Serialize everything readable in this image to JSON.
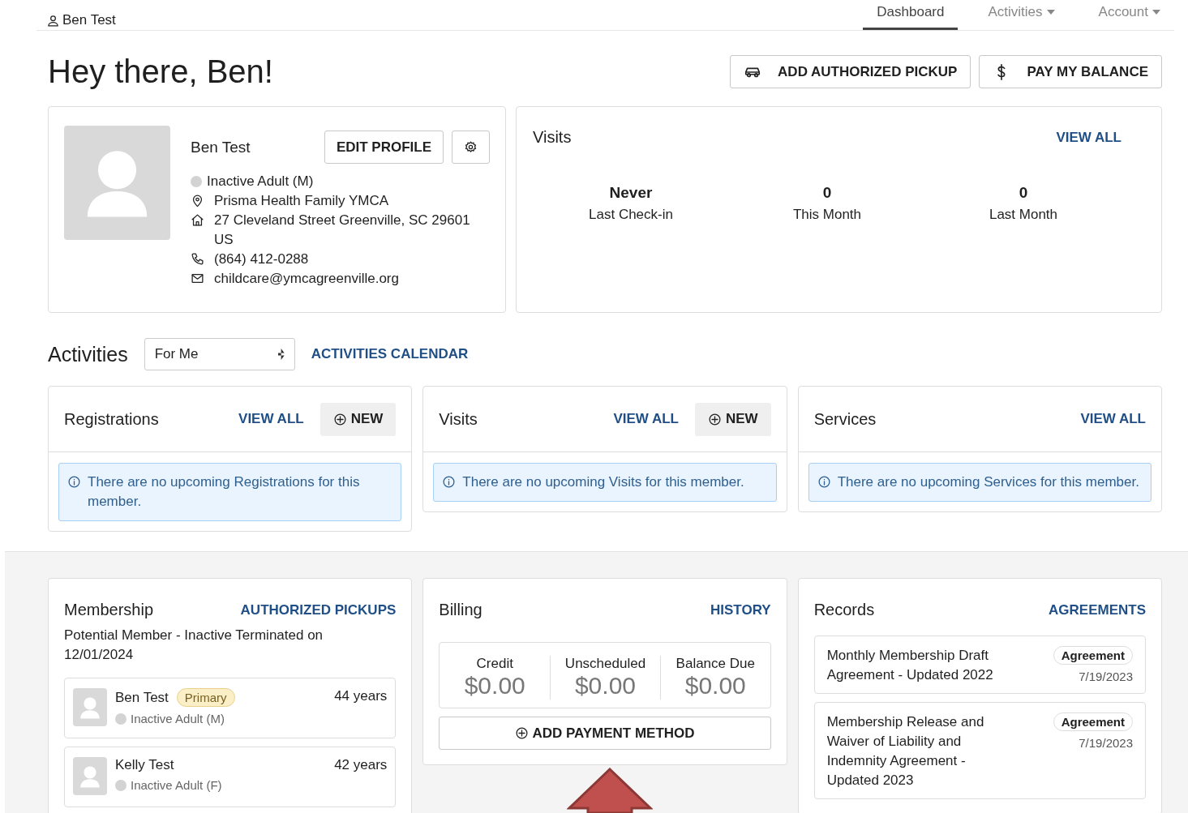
{
  "nav": {
    "user": "Ben Test",
    "tabs": [
      {
        "label": "Dashboard",
        "selected": true,
        "has_menu": false
      },
      {
        "label": "Activities",
        "selected": false,
        "has_menu": true
      },
      {
        "label": "Account",
        "selected": false,
        "has_menu": true
      }
    ]
  },
  "greeting": "Hey there, Ben!",
  "actions": [
    {
      "label": "ADD AUTHORIZED PICKUP",
      "kind": "pickup"
    },
    {
      "label": "PAY MY BALANCE",
      "kind": "payment"
    }
  ],
  "profile": {
    "name": "Ben Test",
    "edit_label": "EDIT PROFILE",
    "status": "Inactive Adult (M)",
    "location": "Prisma Health Family YMCA",
    "address": "27 Cleveland Street Greenville, SC 29601 US",
    "phone": "(864) 412-0288",
    "email": "childcare@ymcagreenville.org"
  },
  "visits": {
    "title": "Visits",
    "link": "VIEW ALL",
    "stats": [
      {
        "value": "Never",
        "label": "Last Check-in"
      },
      {
        "value": "0",
        "label": "This Month"
      },
      {
        "value": "0",
        "label": "Last Month"
      }
    ]
  },
  "activities": {
    "title": "Activities",
    "filter": {
      "value": "For Me"
    },
    "calendar_link": "ACTIVITIES CALENDAR",
    "cards": [
      {
        "title": "Registrations",
        "view_all": "VIEW ALL",
        "new_label": "NEW",
        "message": "There are no upcoming Registrations for this member."
      },
      {
        "title": "Visits",
        "view_all": "VIEW ALL",
        "new_label": "NEW",
        "message": "There are no upcoming Visits for this member."
      },
      {
        "title": "Services",
        "view_all": "VIEW ALL",
        "message": "There are no upcoming Services for this member."
      }
    ]
  },
  "membership": {
    "title": "Membership",
    "link": "AUTHORIZED PICKUPS",
    "status_text": "Potential Member - Inactive Terminated on 12/01/2024",
    "members": [
      {
        "name": "Ben Test",
        "badge": "Primary",
        "age": "44 years",
        "status": "Inactive Adult (M)"
      },
      {
        "name": "Kelly Test",
        "age": "42 years",
        "status": "Inactive Adult (F)"
      }
    ]
  },
  "billing": {
    "title": "Billing",
    "link": "HISTORY",
    "amounts": [
      {
        "label": "Credit",
        "value": "$0.00"
      },
      {
        "label": "Unscheduled",
        "value": "$0.00"
      },
      {
        "label": "Balance Due",
        "value": "$0.00"
      }
    ],
    "button": "ADD PAYMENT METHOD"
  },
  "records": {
    "title": "Records",
    "link": "AGREEMENTS",
    "items": [
      {
        "title": "Monthly Membership Draft Agreement - Updated 2022",
        "tag": "Agreement",
        "date": "7/19/2023"
      },
      {
        "title": "Membership Release and Waiver of Liability and Indemnity Agreement - Updated 2023",
        "tag": "Agreement",
        "date": "7/19/2023"
      }
    ]
  },
  "overlay_arrow": {
    "kind": "up"
  }
}
